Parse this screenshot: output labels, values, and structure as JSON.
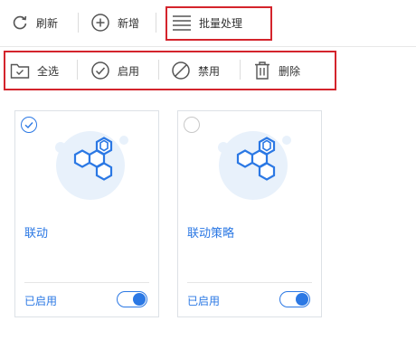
{
  "toolbar": {
    "refresh_label": "刷新",
    "add_label": "新增",
    "batch_label": "批量处理"
  },
  "batchbar": {
    "select_all_label": "全选",
    "enable_label": "启用",
    "disable_label": "禁用",
    "delete_label": "删除"
  },
  "cards": [
    {
      "title": "联动",
      "status": "已启用",
      "selected": true,
      "enabled": true
    },
    {
      "title": "联动策略",
      "status": "已启用",
      "selected": false,
      "enabled": true
    }
  ],
  "colors": {
    "accent": "#2b78e4",
    "highlight_box": "#d4242c",
    "illustration_bg": "#e8f1fb"
  }
}
